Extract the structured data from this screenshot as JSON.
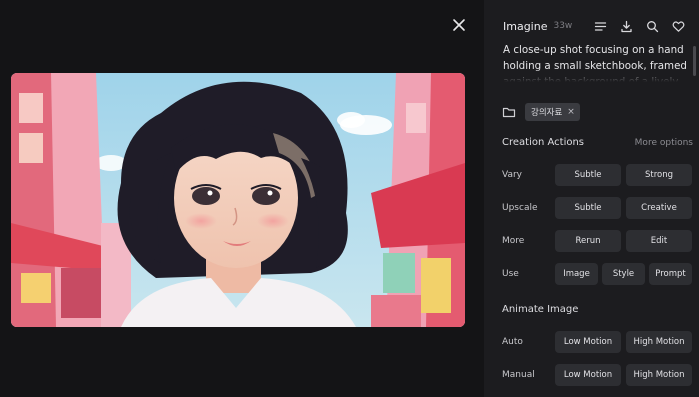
{
  "viewer": {
    "close_icon": "close-icon"
  },
  "panel": {
    "title": "Imagine",
    "badge": "33w",
    "icons": [
      "menu-icon",
      "download-icon",
      "search-icon",
      "heart-icon"
    ],
    "prompt": "A close-up shot focusing on a hand holding a small sketchbook, framed against the background of a lively",
    "tag": "강의자료",
    "tag_remove": "×"
  },
  "creation": {
    "title": "Creation Actions",
    "more": "More options",
    "rows": [
      {
        "label": "Vary",
        "buttons": [
          "Subtle",
          "Strong"
        ]
      },
      {
        "label": "Upscale",
        "buttons": [
          "Subtle",
          "Creative"
        ]
      },
      {
        "label": "More",
        "buttons": [
          "Rerun",
          "Edit"
        ]
      },
      {
        "label": "Use",
        "buttons": [
          "Image",
          "Style",
          "Prompt"
        ]
      }
    ]
  },
  "animate": {
    "title": "Animate Image",
    "rows": [
      {
        "label": "Auto",
        "buttons": [
          "Low Motion",
          "High Motion"
        ]
      },
      {
        "label": "Manual",
        "buttons": [
          "Low Motion",
          "High Motion"
        ]
      }
    ]
  },
  "colors": {
    "panel_bg": "#1c1c1f",
    "viewer_bg": "#141416",
    "button_bg": "#2d2e32"
  }
}
